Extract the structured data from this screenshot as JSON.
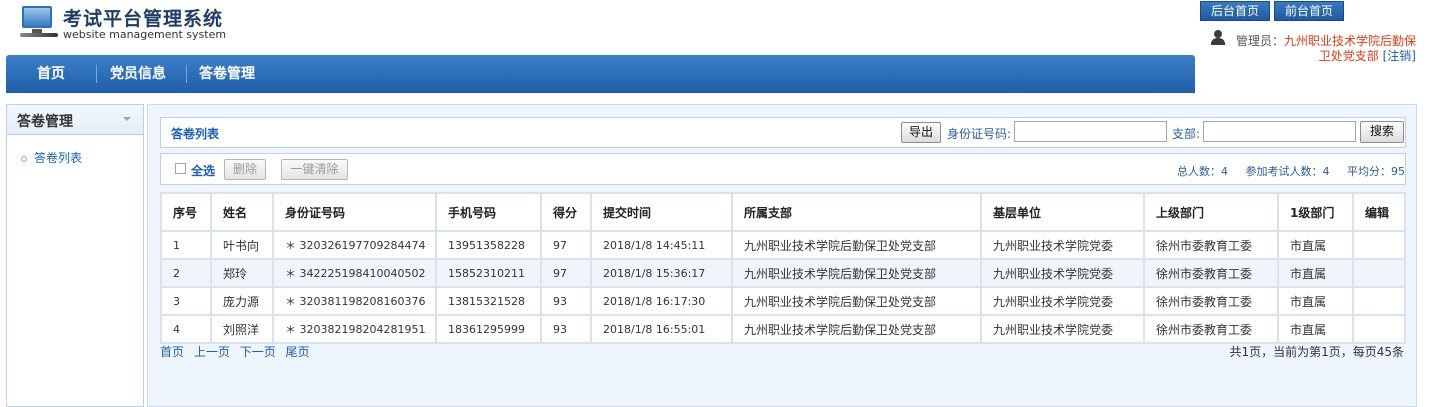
{
  "header": {
    "title": "考试平台管理系统",
    "subtitle": "website management system",
    "back_home_label": "后台首页",
    "front_home_label": "前台首页",
    "user_label": "管理员：",
    "user_dept_line1": "九州职业技术学院后勤保",
    "user_dept_line2": "卫处党支部",
    "logout_label": "[注销]"
  },
  "nav": {
    "items": [
      {
        "label": "首页"
      },
      {
        "label": "党员信息"
      },
      {
        "label": "答卷管理"
      }
    ]
  },
  "sidebar": {
    "title": "答卷管理",
    "items": [
      {
        "label": "答卷列表"
      }
    ]
  },
  "search": {
    "panel_title": "答卷列表",
    "export_label": "导出",
    "id_label": "身份证号码:",
    "id_value": "",
    "branch_label": "支部:",
    "branch_value": "",
    "search_label": "搜索"
  },
  "actions": {
    "select_all_label": "全选",
    "delete_label": "删除",
    "clear_all_label": "一键清除",
    "stats": {
      "total_label": "总人数：4",
      "participants_label": "参加考试人数：4",
      "average_label": "平均分：95"
    }
  },
  "table": {
    "columns": [
      "序号",
      "姓名",
      "身份证号码",
      "手机号码",
      "得分",
      "提交时间",
      "所属支部",
      "基层单位",
      "上级部门",
      "1级部门",
      "编辑"
    ],
    "rows": [
      [
        "1",
        "叶书向",
        "＊ 320326197709284474",
        "13951358228",
        "97",
        "2018/1/8 14:45:11",
        "九州职业技术学院后勤保卫处党支部",
        "九州职业技术学院党委",
        "徐州市委教育工委",
        "市直属",
        ""
      ],
      [
        "2",
        "郑玲",
        "＊ 342225198410040502",
        "15852310211",
        "97",
        "2018/1/8 15:36:17",
        "九州职业技术学院后勤保卫处党支部",
        "九州职业技术学院党委",
        "徐州市委教育工委",
        "市直属",
        ""
      ],
      [
        "3",
        "庞力源",
        "＊ 320381198208160376",
        "13815321528",
        "93",
        "2018/1/8 16:17:30",
        "九州职业技术学院后勤保卫处党支部",
        "九州职业技术学院党委",
        "徐州市委教育工委",
        "市直属",
        ""
      ],
      [
        "4",
        "刘照洋",
        "＊ 320382198204281951",
        "18361295999",
        "93",
        "2018/1/8 16:55:01",
        "九州职业技术学院后勤保卫处党支部",
        "九州职业技术学院党委",
        "徐州市委教育工委",
        "市直属",
        ""
      ]
    ]
  },
  "pager": {
    "first": "首页",
    "prev": "上一页",
    "next": "下一页",
    "last": "尾页",
    "info": "共1页，当前为第1页，每页45条"
  }
}
